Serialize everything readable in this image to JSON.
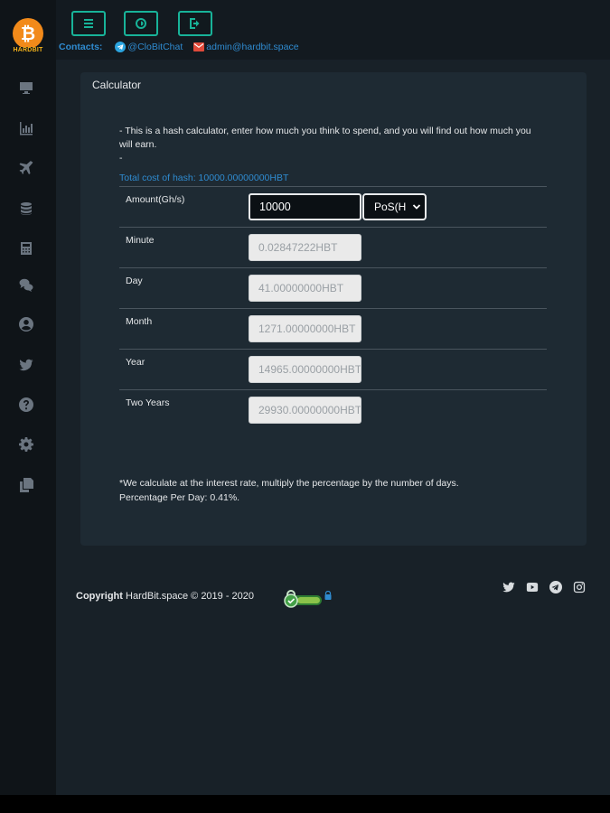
{
  "brand": {
    "coin_symbol": "₿",
    "wordmark": "HARDBIT",
    "accent_color": "#18b399",
    "link_color": "#2f8bd0"
  },
  "sidebar": {
    "items": [
      {
        "icon": "monitor-icon"
      },
      {
        "icon": "bar-chart-icon"
      },
      {
        "icon": "plane-icon"
      },
      {
        "icon": "database-icon"
      },
      {
        "icon": "calculator-icon"
      },
      {
        "icon": "chat-icon"
      },
      {
        "icon": "user-icon"
      },
      {
        "icon": "twitter-icon"
      },
      {
        "icon": "help-icon"
      },
      {
        "icon": "gear-icon"
      },
      {
        "icon": "copy-icon"
      }
    ]
  },
  "topbar": {
    "buttons": [
      {
        "icon": "menu-icon"
      },
      {
        "icon": "theme-icon"
      },
      {
        "icon": "logout-icon"
      }
    ]
  },
  "contacts": {
    "label": "Contacts:",
    "telegram": "@CloBitChat",
    "email": "admin@hardbit.space"
  },
  "calculator": {
    "title": "Calculator",
    "intro_line1": "- This is a hash calculator, enter how much you think to spend, and you will find out how much you will earn.",
    "intro_line2": "-",
    "total_cost": "Total cost of hash: 10000.00000000HBT",
    "rows": [
      {
        "label": "Amount(Gh/s)",
        "value": "10000",
        "unit": "PoS(H"
      },
      {
        "label": "Minute",
        "value": "0.02847222HBT"
      },
      {
        "label": "Day",
        "value": "41.00000000HBT"
      },
      {
        "label": "Month",
        "value": "1271.00000000HBT"
      },
      {
        "label": "Year",
        "value": "14965.00000000HBT"
      },
      {
        "label": "Two Years",
        "value": "29930.00000000HBT"
      }
    ],
    "note_line1": "*We calculate at the interest rate, multiply the percentage by the number of days.",
    "note_line2": "Percentage Per Day: 0.41%."
  },
  "footer": {
    "copyright_bold": "Copyright",
    "copyright_rest": " HardBit.space © 2019 - 2020",
    "social": [
      "twitter-icon",
      "youtube-icon",
      "telegram-icon",
      "instagram-icon"
    ]
  }
}
